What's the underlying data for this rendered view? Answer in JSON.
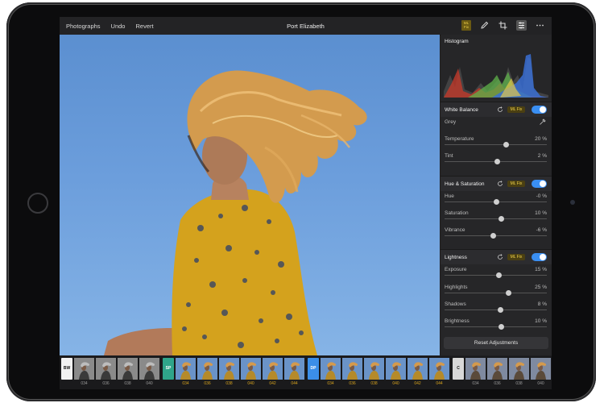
{
  "topbar": {
    "nav": [
      "Photographs",
      "Undo",
      "Revert"
    ],
    "title": "Port Elizabeth",
    "ml_badge": "ML\nFix",
    "icons": [
      "pencil-icon",
      "crop-icon",
      "adjustments-icon",
      "more-icon"
    ]
  },
  "panel": {
    "histogram_title": "Histogram",
    "sections": [
      {
        "name": "White Balance",
        "ml_fix": "ML Fix",
        "enabled": true,
        "rows": [
          {
            "label": "Grey",
            "value": "",
            "fraction": null
          },
          {
            "label": "Temperature",
            "value": "20 %",
            "fraction": 0.6
          },
          {
            "label": "Tint",
            "value": "2 %",
            "fraction": 0.51
          }
        ]
      },
      {
        "name": "Hue & Saturation",
        "ml_fix": "ML Fix",
        "enabled": true,
        "rows": [
          {
            "label": "Hue",
            "value": "-0 %",
            "fraction": 0.5
          },
          {
            "label": "Saturation",
            "value": "10 %",
            "fraction": 0.55
          },
          {
            "label": "Vibrance",
            "value": "-6 %",
            "fraction": 0.47
          }
        ]
      },
      {
        "name": "Lightness",
        "ml_fix": "ML Fix",
        "enabled": true,
        "rows": [
          {
            "label": "Exposure",
            "value": "15 %",
            "fraction": 0.53
          },
          {
            "label": "Highlights",
            "value": "25 %",
            "fraction": 0.62
          },
          {
            "label": "Shadows",
            "value": "8 %",
            "fraction": 0.54
          },
          {
            "label": "Brightness",
            "value": "10 %",
            "fraction": 0.55
          }
        ]
      }
    ],
    "reset_label": "Reset Adjustments"
  },
  "filmstrip": {
    "groups": [
      {
        "label": "BW",
        "label_bg": "#f2f2f2",
        "label_fg": "#111111",
        "num_color": "#9a9a9a",
        "items": [
          "034",
          "036",
          "038",
          "040"
        ]
      },
      {
        "label": "SP",
        "label_bg": "#2fa58a",
        "label_fg": "#ffffff",
        "num_color": "#d6a21d",
        "items": [
          "034",
          "036",
          "038",
          "040",
          "042",
          "044"
        ]
      },
      {
        "label": "DP",
        "label_bg": "#3b8ee8",
        "label_fg": "#ffffff",
        "num_color": "#d6a21d",
        "items": [
          "034",
          "036",
          "038",
          "040",
          "042",
          "044"
        ]
      },
      {
        "label": "C",
        "label_bg": "#d8d8d8",
        "label_fg": "#111111",
        "num_color": "#9a9a9a",
        "items": [
          "034",
          "036",
          "038",
          "040"
        ]
      }
    ]
  },
  "colors": {
    "accent": "#3a8ff3",
    "ml_gold": "#f0d24a"
  }
}
